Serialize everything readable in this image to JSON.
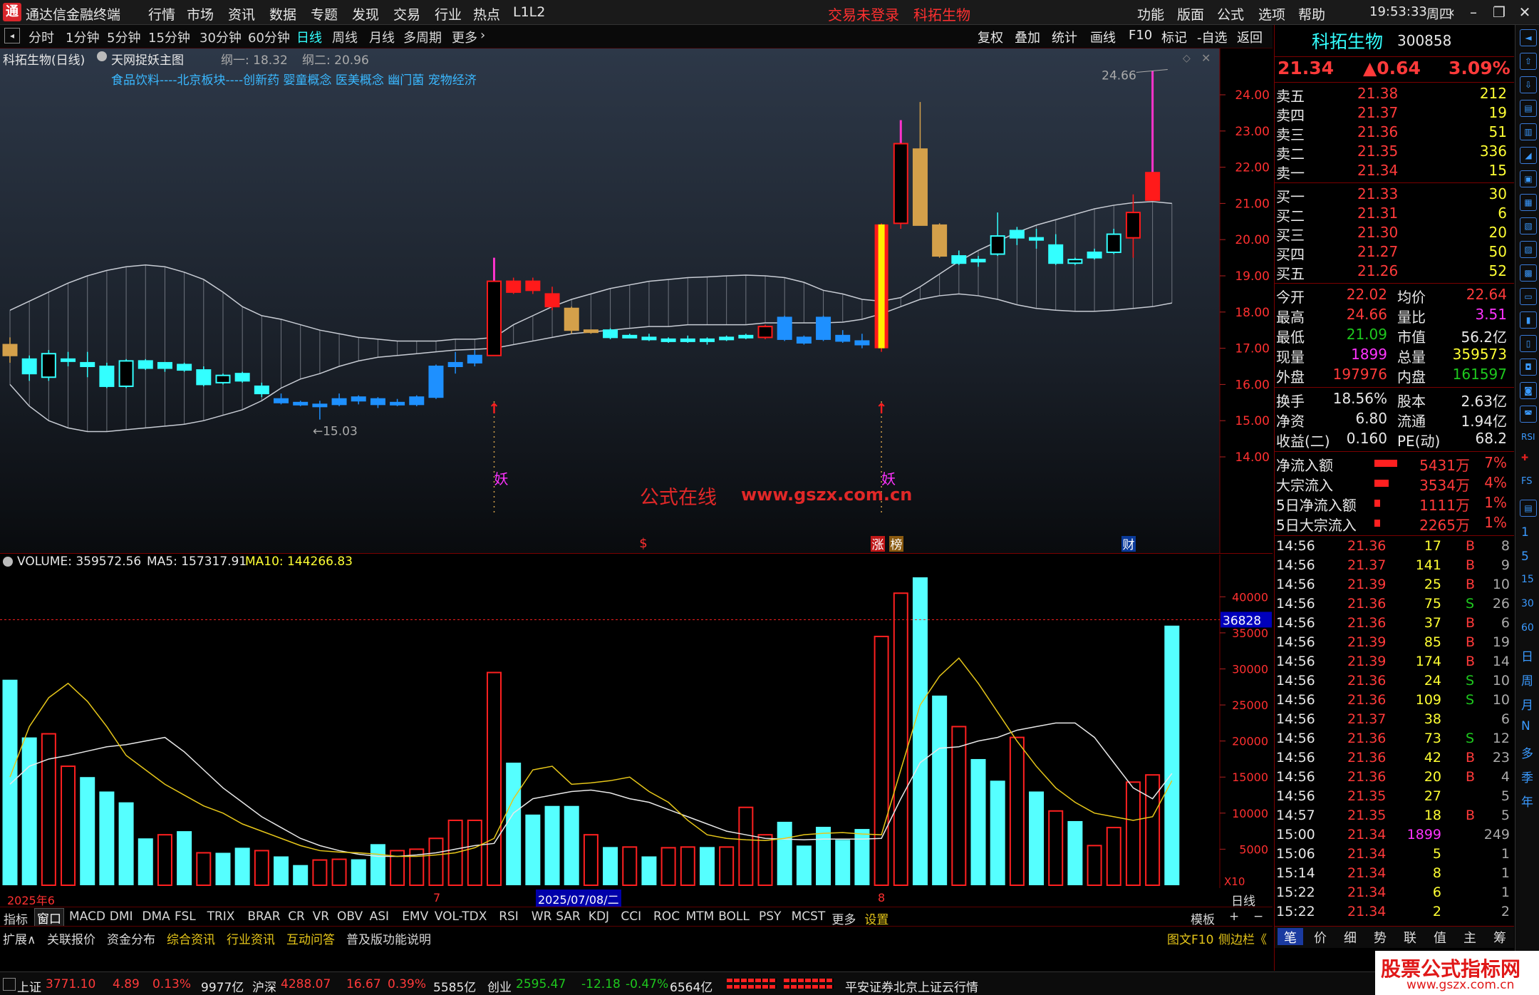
{
  "app": {
    "title": "通达信金融终端",
    "menu": [
      "行情",
      "市场",
      "资讯",
      "数据",
      "专题",
      "发现",
      "交易",
      "行业",
      "热点",
      "L1L2"
    ],
    "login_status": "交易未登录",
    "stock_name_header": "科拓生物",
    "right_menu": [
      "功能",
      "版面",
      "公式",
      "选项",
      "帮助"
    ],
    "time": "19:53:33",
    "weekday": "周四"
  },
  "toolbar": {
    "periods": [
      "分时",
      "1分钟",
      "5分钟",
      "15分钟",
      "30分钟",
      "60分钟",
      "日线",
      "周线",
      "月线",
      "多周期",
      "更多"
    ],
    "active_period": "日线",
    "actions": [
      "复权",
      "叠加",
      "统计",
      "画线",
      "F10",
      "标记",
      "-自选",
      "返回"
    ]
  },
  "main_chart": {
    "stock_label": "科拓生物(日线)",
    "indicator_name": "天网捉妖主图",
    "line1": "纲一: 18.32",
    "line2": "纲二: 20.96",
    "concepts": "食品饮料----北京板块----创新药 婴童概念 医美概念 幽门菌 宠物经济",
    "high_label": "24.66",
    "low_label": "15.03",
    "yao_label": "妖",
    "watermark_cn": "公式在线",
    "watermark_url": "www.gszx.com.cn",
    "price_ticks": [
      "24.00",
      "23.00",
      "22.00",
      "21.00",
      "20.00",
      "19.00",
      "18.00",
      "17.00",
      "16.00",
      "15.00",
      "14.00"
    ],
    "markers": {
      "dollar": "$",
      "zhang": "涨",
      "bang": "榜",
      "cai": "财"
    }
  },
  "vol_chart": {
    "header_volume": "VOLUME: 359572.56",
    "header_ma5": "MA5: 157317.91",
    "header_ma10": "MA10: 144266.83",
    "ticks": [
      "40000",
      "35000",
      "30000",
      "25000",
      "20000",
      "15000",
      "10000",
      "5000"
    ],
    "highlight_tick": "36828",
    "scale_label": "X10",
    "x_labels": {
      "year": "2025年6",
      "m7": "7",
      "date": "2025/07/08/二",
      "m8": "8"
    },
    "period_label": "日线"
  },
  "indicator_tabs": [
    "指标",
    "窗口",
    "MACD",
    "DMI",
    "DMA",
    "FSL",
    "TRIX",
    "BRAR",
    "CR",
    "VR",
    "OBV",
    "ASI",
    "EMV",
    "VOL-TDX",
    "RSI",
    "WR",
    "SAR",
    "KDJ",
    "CCI",
    "ROC",
    "MTM",
    "BOLL",
    "PSY",
    "MCST",
    "更多",
    "设置"
  ],
  "template_label": "模板",
  "ext_tabs": [
    "扩展∧",
    "关联报价",
    "资金分布",
    "综合资讯",
    "行业资讯",
    "互动问答",
    "普及版功能说明"
  ],
  "ext_right": [
    "图文F10",
    "侧边栏《"
  ],
  "quote": {
    "name": "科拓生物",
    "code": "300858",
    "price": "21.34",
    "change": "▲0.64",
    "pct": "3.09%",
    "asks": [
      {
        "label": "卖五",
        "price": "21.38",
        "vol": "212"
      },
      {
        "label": "卖四",
        "price": "21.37",
        "vol": "19"
      },
      {
        "label": "卖三",
        "price": "21.36",
        "vol": "51"
      },
      {
        "label": "卖二",
        "price": "21.35",
        "vol": "336"
      },
      {
        "label": "卖一",
        "price": "21.34",
        "vol": "15"
      }
    ],
    "bids": [
      {
        "label": "买一",
        "price": "21.33",
        "vol": "30"
      },
      {
        "label": "买二",
        "price": "21.31",
        "vol": "6"
      },
      {
        "label": "买三",
        "price": "21.30",
        "vol": "20"
      },
      {
        "label": "买四",
        "price": "21.27",
        "vol": "50"
      },
      {
        "label": "买五",
        "price": "21.26",
        "vol": "52"
      }
    ],
    "stats1": [
      {
        "k1": "今开",
        "v1": "22.02",
        "k2": "均价",
        "v2": "22.64"
      },
      {
        "k1": "最高",
        "v1": "24.66",
        "k2": "量比",
        "v2": "3.51"
      },
      {
        "k1": "最低",
        "v1": "21.09",
        "k2": "市值",
        "v2": "56.2亿"
      },
      {
        "k1": "现量",
        "v1": "1899",
        "k2": "总量",
        "v2": "359573"
      },
      {
        "k1": "外盘",
        "v1": "197976",
        "k2": "内盘",
        "v2": "161597"
      }
    ],
    "stats2": [
      {
        "k1": "换手",
        "v1": "18.56%",
        "k2": "股本",
        "v2": "2.63亿"
      },
      {
        "k1": "净资",
        "v1": "6.80",
        "k2": "流通",
        "v2": "1.94亿"
      },
      {
        "k1": "收益(二)",
        "v1": "0.160",
        "k2": "PE(动)",
        "v2": "68.2"
      }
    ],
    "flows": [
      {
        "label": "净流入额",
        "value": "5431万",
        "pct": "7%",
        "bar": 0.7
      },
      {
        "label": "大宗流入",
        "value": "3534万",
        "pct": "4%",
        "bar": 0.4
      },
      {
        "label": "5日净流入额",
        "value": "1111万",
        "pct": "1%",
        "bar": 0.1
      },
      {
        "label": "5日大宗流入",
        "value": "2265万",
        "pct": "1%",
        "bar": 0.1
      }
    ],
    "ticks": [
      [
        "14:56",
        "21.36",
        "17",
        "B",
        "8"
      ],
      [
        "14:56",
        "21.37",
        "141",
        "B",
        "9"
      ],
      [
        "14:56",
        "21.39",
        "25",
        "B",
        "10"
      ],
      [
        "14:56",
        "21.36",
        "75",
        "S",
        "26"
      ],
      [
        "14:56",
        "21.36",
        "37",
        "B",
        "6"
      ],
      [
        "14:56",
        "21.39",
        "85",
        "B",
        "19"
      ],
      [
        "14:56",
        "21.39",
        "174",
        "B",
        "14"
      ],
      [
        "14:56",
        "21.36",
        "24",
        "S",
        "10"
      ],
      [
        "14:56",
        "21.36",
        "109",
        "S",
        "10"
      ],
      [
        "14:56",
        "21.37",
        "38",
        "",
        "6"
      ],
      [
        "14:56",
        "21.36",
        "73",
        "S",
        "12"
      ],
      [
        "14:56",
        "21.36",
        "42",
        "B",
        "23"
      ],
      [
        "14:56",
        "21.36",
        "20",
        "B",
        "4"
      ],
      [
        "14:56",
        "21.35",
        "27",
        "",
        "5"
      ],
      [
        "14:57",
        "21.35",
        "18",
        "B",
        "5"
      ],
      [
        "15:00",
        "21.34",
        "1899",
        "",
        "249"
      ],
      [
        "15:06",
        "21.34",
        "5",
        "",
        "1"
      ],
      [
        "15:14",
        "21.34",
        "8",
        "",
        "1"
      ],
      [
        "15:22",
        "21.34",
        "6",
        "",
        "1"
      ],
      [
        "15:22",
        "21.34",
        "2",
        "",
        "2"
      ]
    ],
    "bottom_tabs": [
      "笔",
      "价",
      "细",
      "势",
      "联",
      "值",
      "主",
      "筹"
    ]
  },
  "sidebar": {
    "labels": [
      "RSI",
      "FS",
      "1",
      "5",
      "15",
      "30",
      "60",
      "日",
      "周",
      "月",
      "N",
      "多",
      "季",
      "年"
    ]
  },
  "statusbar": {
    "sh_label": "上证",
    "sh_val": "3771.10",
    "sh_chg": "4.89",
    "sh_pct": "0.13%",
    "sh_amt": "9977亿",
    "sz_label": "沪深",
    "sz_val": "4288.07",
    "sz_chg": "16.67",
    "sz_pct": "0.39%",
    "sz_amt": "5585亿",
    "cy_label": "创业",
    "cy_val": "2595.47",
    "cy_chg": "-12.18",
    "cy_pct": "-0.47%",
    "cy_amt": "6564亿",
    "broker": "平安证券北京上证云行情",
    "brand_logo": "股票公式指标网",
    "brand_url": "www.gszx.com.cn"
  },
  "chart_data": {
    "type": "candlestick",
    "candles": [
      {
        "o": 17.1,
        "h": 17.3,
        "l": 16.6,
        "c": 16.8,
        "col": "gold"
      },
      {
        "o": 16.7,
        "h": 16.8,
        "l": 16.1,
        "c": 16.3,
        "col": "cyan"
      },
      {
        "o": 16.2,
        "h": 16.95,
        "l": 16.1,
        "c": 16.85,
        "col": "cyanh"
      },
      {
        "o": 16.65,
        "h": 16.9,
        "l": 16.5,
        "c": 16.7,
        "col": "cyan"
      },
      {
        "o": 16.5,
        "h": 16.9,
        "l": 16.2,
        "c": 16.6,
        "col": "cyan"
      },
      {
        "o": 16.5,
        "h": 16.6,
        "l": 15.9,
        "c": 15.95,
        "col": "cyan"
      },
      {
        "o": 15.95,
        "h": 16.7,
        "l": 15.9,
        "c": 16.65,
        "col": "cyanh"
      },
      {
        "o": 16.65,
        "h": 16.7,
        "l": 16.4,
        "c": 16.45,
        "col": "cyan"
      },
      {
        "o": 16.45,
        "h": 16.6,
        "l": 16.35,
        "c": 16.6,
        "col": "cyan"
      },
      {
        "o": 16.55,
        "h": 16.6,
        "l": 16.35,
        "c": 16.4,
        "col": "cyan"
      },
      {
        "o": 16.4,
        "h": 16.5,
        "l": 15.95,
        "c": 16.0,
        "col": "cyan"
      },
      {
        "o": 16.05,
        "h": 16.3,
        "l": 16.0,
        "c": 16.25,
        "col": "cyanh"
      },
      {
        "o": 16.3,
        "h": 16.35,
        "l": 16.05,
        "c": 16.1,
        "col": "cyan"
      },
      {
        "o": 15.95,
        "h": 16.05,
        "l": 15.65,
        "c": 15.75,
        "col": "cyan"
      },
      {
        "o": 15.6,
        "h": 15.75,
        "l": 15.45,
        "c": 15.5,
        "col": "blue"
      },
      {
        "o": 15.5,
        "h": 15.55,
        "l": 15.4,
        "c": 15.45,
        "col": "blue"
      },
      {
        "o": 15.45,
        "h": 15.55,
        "l": 15.03,
        "c": 15.4,
        "col": "blue"
      },
      {
        "o": 15.45,
        "h": 15.75,
        "l": 15.4,
        "c": 15.6,
        "col": "blue"
      },
      {
        "o": 15.55,
        "h": 15.7,
        "l": 15.45,
        "c": 15.65,
        "col": "blue"
      },
      {
        "o": 15.6,
        "h": 15.65,
        "l": 15.35,
        "c": 15.45,
        "col": "blue"
      },
      {
        "o": 15.45,
        "h": 15.6,
        "l": 15.4,
        "c": 15.5,
        "col": "blue"
      },
      {
        "o": 15.45,
        "h": 15.7,
        "l": 15.4,
        "c": 15.65,
        "col": "blue"
      },
      {
        "o": 15.65,
        "h": 16.55,
        "l": 15.6,
        "c": 16.5,
        "col": "blue"
      },
      {
        "o": 16.5,
        "h": 16.9,
        "l": 16.3,
        "c": 16.6,
        "col": "blue"
      },
      {
        "o": 16.6,
        "h": 16.95,
        "l": 16.5,
        "c": 16.8,
        "col": "blue"
      },
      {
        "o": 16.8,
        "h": 19.5,
        "l": 16.8,
        "c": 18.85,
        "col": "redh",
        "pink": true
      },
      {
        "o": 18.85,
        "h": 18.95,
        "l": 18.5,
        "c": 18.55,
        "col": "red"
      },
      {
        "o": 18.85,
        "h": 18.95,
        "l": 18.5,
        "c": 18.6,
        "col": "red"
      },
      {
        "o": 18.5,
        "h": 18.7,
        "l": 18.05,
        "c": 18.15,
        "col": "red"
      },
      {
        "o": 18.1,
        "h": 18.15,
        "l": 17.4,
        "c": 17.5,
        "col": "gold"
      },
      {
        "o": 17.5,
        "h": 17.5,
        "l": 17.4,
        "c": 17.45,
        "col": "gold"
      },
      {
        "o": 17.5,
        "h": 17.55,
        "l": 17.25,
        "c": 17.3,
        "col": "cyan"
      },
      {
        "o": 17.35,
        "h": 17.4,
        "l": 17.3,
        "c": 17.35,
        "col": "cyan"
      },
      {
        "o": 17.3,
        "h": 17.4,
        "l": 17.2,
        "c": 17.25,
        "col": "cyan"
      },
      {
        "o": 17.25,
        "h": 17.3,
        "l": 17.15,
        "c": 17.2,
        "col": "cyan"
      },
      {
        "o": 17.25,
        "h": 17.35,
        "l": 17.15,
        "c": 17.2,
        "col": "cyan"
      },
      {
        "o": 17.2,
        "h": 17.3,
        "l": 17.1,
        "c": 17.25,
        "col": "cyan"
      },
      {
        "o": 17.25,
        "h": 17.35,
        "l": 17.2,
        "c": 17.3,
        "col": "cyan"
      },
      {
        "o": 17.3,
        "h": 17.4,
        "l": 17.25,
        "c": 17.35,
        "col": "cyan"
      },
      {
        "o": 17.3,
        "h": 17.65,
        "l": 17.25,
        "c": 17.6,
        "col": "redh"
      },
      {
        "o": 17.85,
        "h": 17.9,
        "l": 17.2,
        "c": 17.25,
        "col": "blue"
      },
      {
        "o": 17.3,
        "h": 17.35,
        "l": 17.1,
        "c": 17.15,
        "col": "blue"
      },
      {
        "o": 17.85,
        "h": 17.9,
        "l": 17.2,
        "c": 17.25,
        "col": "blue"
      },
      {
        "o": 17.35,
        "h": 17.5,
        "l": 17.15,
        "c": 17.2,
        "col": "blue"
      },
      {
        "o": 17.2,
        "h": 17.4,
        "l": 17.0,
        "c": 17.1,
        "col": "blue"
      },
      {
        "o": 17.0,
        "h": 20.45,
        "l": 16.9,
        "c": 20.42,
        "col": "yao"
      },
      {
        "o": 20.45,
        "h": 23.3,
        "l": 20.3,
        "c": 22.65,
        "col": "redh",
        "pink": true
      },
      {
        "o": 22.5,
        "h": 23.8,
        "l": 20.4,
        "c": 20.4,
        "col": "gold"
      },
      {
        "o": 20.4,
        "h": 20.45,
        "l": 19.5,
        "c": 19.55,
        "col": "gold"
      },
      {
        "o": 19.55,
        "h": 19.7,
        "l": 19.3,
        "c": 19.35,
        "col": "cyan"
      },
      {
        "o": 19.4,
        "h": 19.55,
        "l": 19.25,
        "c": 19.45,
        "col": "cyan"
      },
      {
        "o": 19.6,
        "h": 20.75,
        "l": 19.55,
        "c": 20.1,
        "col": "cyanh"
      },
      {
        "o": 20.05,
        "h": 20.35,
        "l": 19.85,
        "c": 20.25,
        "col": "cyan"
      },
      {
        "o": 20.0,
        "h": 20.3,
        "l": 19.75,
        "c": 20.05,
        "col": "cyan"
      },
      {
        "o": 19.85,
        "h": 20.15,
        "l": 19.3,
        "c": 19.35,
        "col": "cyan"
      },
      {
        "o": 19.35,
        "h": 19.5,
        "l": 19.3,
        "c": 19.45,
        "col": "cyanh"
      },
      {
        "o": 19.5,
        "h": 19.75,
        "l": 19.45,
        "c": 19.65,
        "col": "cyan"
      },
      {
        "o": 19.65,
        "h": 20.3,
        "l": 19.6,
        "c": 20.15,
        "col": "cyanh"
      },
      {
        "o": 20.05,
        "h": 21.25,
        "l": 19.5,
        "c": 20.75,
        "col": "redh"
      },
      {
        "o": 21.09,
        "h": 24.66,
        "l": 21.09,
        "c": 21.85,
        "col": "red",
        "pink": true
      }
    ],
    "upper_band": [
      18.05,
      18.3,
      18.55,
      18.8,
      19.0,
      19.15,
      19.25,
      19.3,
      19.25,
      19.1,
      18.9,
      18.55,
      18.15,
      17.9,
      17.8,
      17.65,
      17.5,
      17.4,
      17.3,
      17.25,
      17.2,
      17.2,
      17.2,
      17.25,
      17.25,
      17.3,
      17.65,
      17.9,
      18.15,
      18.35,
      18.5,
      18.65,
      18.75,
      18.85,
      18.9,
      18.95,
      18.97,
      19.0,
      19.02,
      19.0,
      18.95,
      18.82,
      18.6,
      18.5,
      18.35,
      18.3,
      18.4,
      18.7,
      19.05,
      19.4,
      19.7,
      19.95,
      20.2,
      20.4,
      20.55,
      20.7,
      20.85,
      20.95,
      21.02,
      21.05,
      21.0
    ],
    "lower_band": [
      16.0,
      15.4,
      15.0,
      14.8,
      14.7,
      14.7,
      14.75,
      14.8,
      14.85,
      14.9,
      15.0,
      15.15,
      15.3,
      15.55,
      15.9,
      16.15,
      16.3,
      16.5,
      16.65,
      16.75,
      16.8,
      16.85,
      16.9,
      16.95,
      16.97,
      17.0,
      17.1,
      17.2,
      17.3,
      17.4,
      17.45,
      17.5,
      17.55,
      17.6,
      17.6,
      17.65,
      17.65,
      17.65,
      17.65,
      17.7,
      17.7,
      17.7,
      17.7,
      17.72,
      17.8,
      17.95,
      18.15,
      18.35,
      18.45,
      18.5,
      18.45,
      18.35,
      18.2,
      18.1,
      18.05,
      18.02,
      18.02,
      18.05,
      18.1,
      18.15,
      18.25
    ],
    "volume": [
      28500,
      20500,
      21000,
      16500,
      15000,
      13000,
      11500,
      6500,
      7000,
      7500,
      4500,
      4500,
      5200,
      4800,
      4000,
      2800,
      3500,
      3600,
      3600,
      5700,
      4800,
      5000,
      6500,
      9000,
      9000,
      29500,
      17000,
      9800,
      11000,
      11000,
      7000,
      5300,
      5300,
      4000,
      5200,
      5300,
      5300,
      5300,
      10800,
      7000,
      8800,
      5500,
      8100,
      6300,
      7800,
      34500,
      40500,
      42700,
      26300,
      22000,
      17500,
      14500,
      20500,
      13000,
      10300,
      8900,
      5500,
      8000,
      14300,
      15300,
      36000
    ],
    "vol_dir": [
      "c",
      "c",
      "r",
      "r",
      "c",
      "c",
      "c",
      "c",
      "r",
      "c",
      "r",
      "c",
      "c",
      "r",
      "c",
      "c",
      "r",
      "r",
      "c",
      "c",
      "r",
      "r",
      "r",
      "r",
      "r",
      "r",
      "c",
      "c",
      "c",
      "c",
      "r",
      "c",
      "r",
      "c",
      "r",
      "r",
      "c",
      "r",
      "r",
      "r",
      "c",
      "c",
      "c",
      "c",
      "c",
      "r",
      "r",
      "c",
      "c",
      "r",
      "c",
      "c",
      "r",
      "c",
      "r",
      "c",
      "r",
      "r",
      "r",
      "r",
      "c"
    ],
    "ma5": [
      14000,
      16500,
      17500,
      18000,
      18600,
      19200,
      19500,
      20000,
      20500,
      18500,
      16000,
      13500,
      11500,
      9500,
      8000,
      6500,
      5500,
      4800,
      4300,
      4000,
      4000,
      4200,
      4500,
      5000,
      5500,
      5800,
      10000,
      12000,
      12500,
      13000,
      13200,
      12800,
      12000,
      11500,
      10500,
      9500,
      8500,
      7500,
      7000,
      6500,
      6400,
      6300,
      6400,
      6400,
      6400,
      6500,
      12000,
      17000,
      19000,
      19200,
      20000,
      20500,
      21500,
      22000,
      22500,
      22500,
      20500,
      17000,
      13500,
      12000,
      15500
    ],
    "ma10": [
      15000,
      22000,
      26000,
      28000,
      25500,
      22000,
      18000,
      16000,
      14000,
      12500,
      11000,
      10000,
      8500,
      7500,
      6500,
      5500,
      4800,
      4600,
      4500,
      4300,
      4000,
      4000,
      4200,
      4500,
      5200,
      6500,
      12000,
      16000,
      16500,
      14000,
      14200,
      14500,
      15000,
      13000,
      11500,
      9000,
      7000,
      6500,
      6300,
      6200,
      6500,
      7000,
      7200,
      7300,
      7100,
      7000,
      16000,
      25000,
      29000,
      31500,
      28000,
      24000,
      20000,
      16500,
      13500,
      11500,
      10000,
      9500,
      9000,
      9500,
      14500
    ]
  }
}
